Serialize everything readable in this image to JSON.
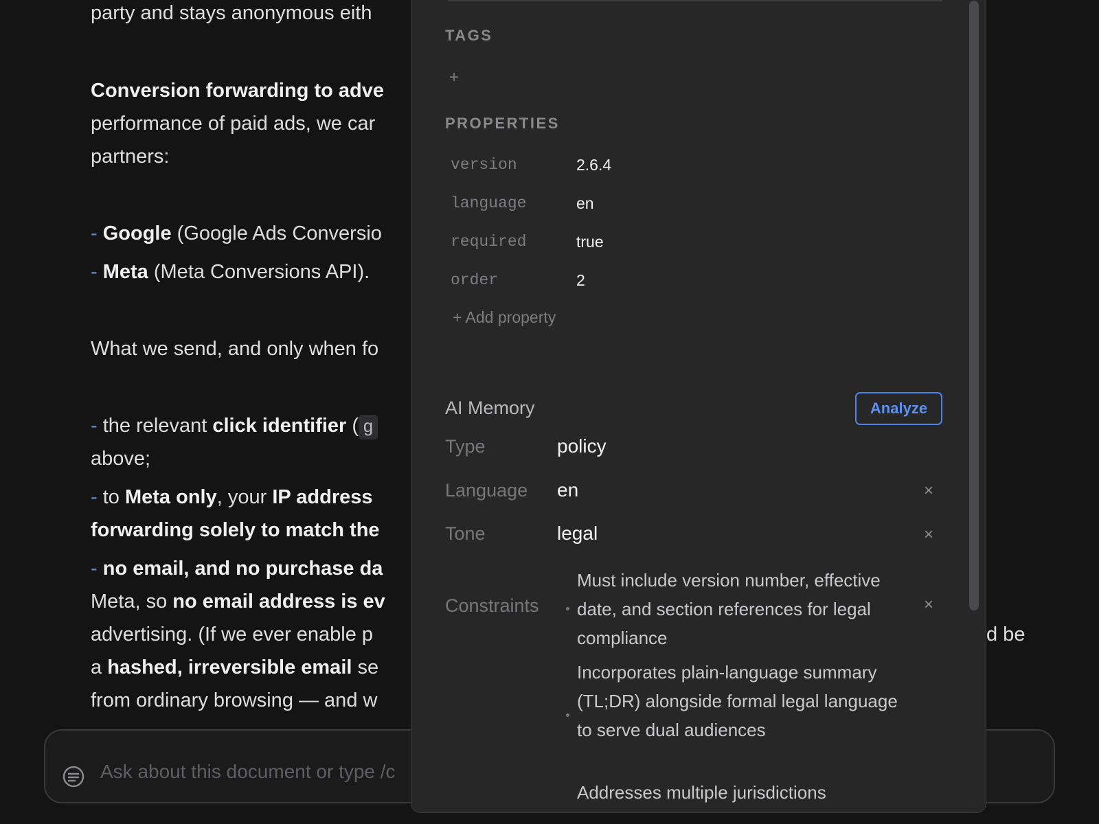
{
  "document": {
    "line1": "party and stays anonymous eith",
    "line2_bold": "Conversion forwarding to adve",
    "line3": "performance of paid ads, we car",
    "line4": "partners:",
    "google_dash": "-",
    "google_bold": "Google",
    "google_rest": " (Google Ads Conversio",
    "meta_dash": "-",
    "meta_bold": "Meta",
    "meta_rest": " (Meta Conversions API).",
    "what_we_send": "What we send, and only when fo",
    "click_dash": "-",
    "click_pre": " the relevant ",
    "click_bold": "click identifier",
    "click_paren": " (",
    "click_code": "g",
    "above": "above;",
    "ip_dash": "-",
    "ip_to": " to ",
    "ip_bold1": "Meta only",
    "ip_mid": ", your ",
    "ip_bold2": "IP address",
    "forwarding_bold": "forwarding solely to match the",
    "noemail_dash": "-",
    "noemail_bold": "no email, and no purchase da",
    "meta_so": "Meta, so ",
    "meta_so_bold": "no email address is ev",
    "advertising": "advertising. (If we ever enable p",
    "advertising_tail": "d be",
    "a_pre": "a ",
    "a_bold": "hashed, irreversible email",
    "a_rest": " se",
    "from_browsing": "from ordinary browsing — and w"
  },
  "chat": {
    "placeholder": "Ask about this document or type /c",
    "icon": "chat-bubble-icon"
  },
  "panel": {
    "tags_heading": "TAGS",
    "add_tag": "+",
    "properties_heading": "PROPERTIES",
    "properties": [
      {
        "key": "version",
        "value": "2.6.4"
      },
      {
        "key": "language",
        "value": "en"
      },
      {
        "key": "required",
        "value": "true"
      },
      {
        "key": "order",
        "value": "2"
      }
    ],
    "add_property": "+ Add property",
    "ai_memory_title": "AI Memory",
    "analyze_label": "Analyze",
    "memory": {
      "type_label": "Type",
      "type_value": "policy",
      "language_label": "Language",
      "language_value": "en",
      "tone_label": "Tone",
      "tone_value": "legal",
      "constraints_label": "Constraints",
      "remove_symbol": "×",
      "constraints": [
        "Must include version number, effective date, and section references for legal compliance",
        "Incorporates plain-language summary (TL;DR) alongside formal legal language to serve dual audiences",
        "Addresses multiple jurisdictions"
      ]
    }
  },
  "colors": {
    "background": "#141415",
    "panel": "#272728",
    "accent": "#4e83e8",
    "dash": "#5a8fd6"
  }
}
